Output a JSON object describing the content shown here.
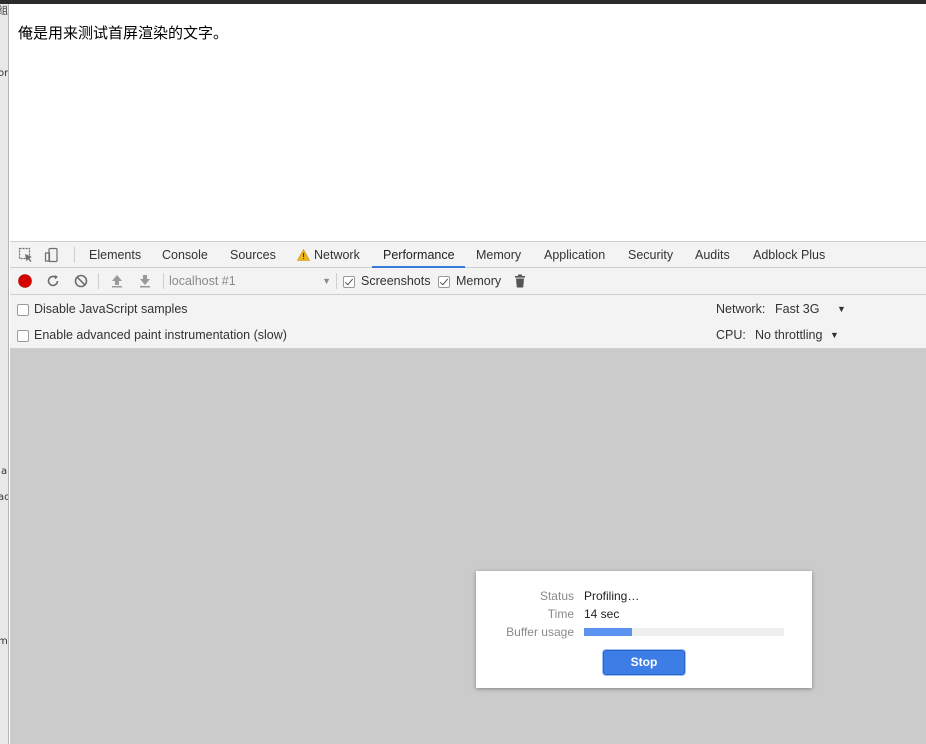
{
  "page": {
    "text": "俺是用来测试首屏渲染的文字。"
  },
  "left_fragments": [
    "组",
    "or",
    "Ja",
    "ac",
    "m"
  ],
  "tabs": [
    {
      "label": "Elements"
    },
    {
      "label": "Console"
    },
    {
      "label": "Sources"
    },
    {
      "label": "Network",
      "icon": "warning-icon"
    },
    {
      "label": "Performance",
      "active": true
    },
    {
      "label": "Memory"
    },
    {
      "label": "Application"
    },
    {
      "label": "Security"
    },
    {
      "label": "Audits"
    },
    {
      "label": "Adblock Plus"
    }
  ],
  "toolbar": {
    "target_select": "localhost #1",
    "screenshots_label": "Screenshots",
    "screenshots_checked": true,
    "memory_label": "Memory",
    "memory_checked": true,
    "icons": [
      "record-icon",
      "reload-icon",
      "clear-icon",
      "upload-icon",
      "download-icon",
      "trash-icon"
    ]
  },
  "settings": {
    "disable_js_samples": "Disable JavaScript samples",
    "advanced_paint": "Enable advanced paint instrumentation (slow)",
    "network_label": "Network:",
    "network_value": "Fast 3G",
    "cpu_label": "CPU:",
    "cpu_value": "No throttling"
  },
  "status_dialog": {
    "status_label": "Status",
    "status_value": "Profiling…",
    "time_label": "Time",
    "time_value": "14 sec",
    "buffer_label": "Buffer usage",
    "buffer_fraction": 0.24,
    "stop_label": "Stop"
  },
  "colors": {
    "accent": "#3879d9",
    "record": "#d50000",
    "stop_button": "#3d7de6",
    "buffer_fill": "#5a93ef",
    "panel_bg": "#cbcbcb"
  }
}
